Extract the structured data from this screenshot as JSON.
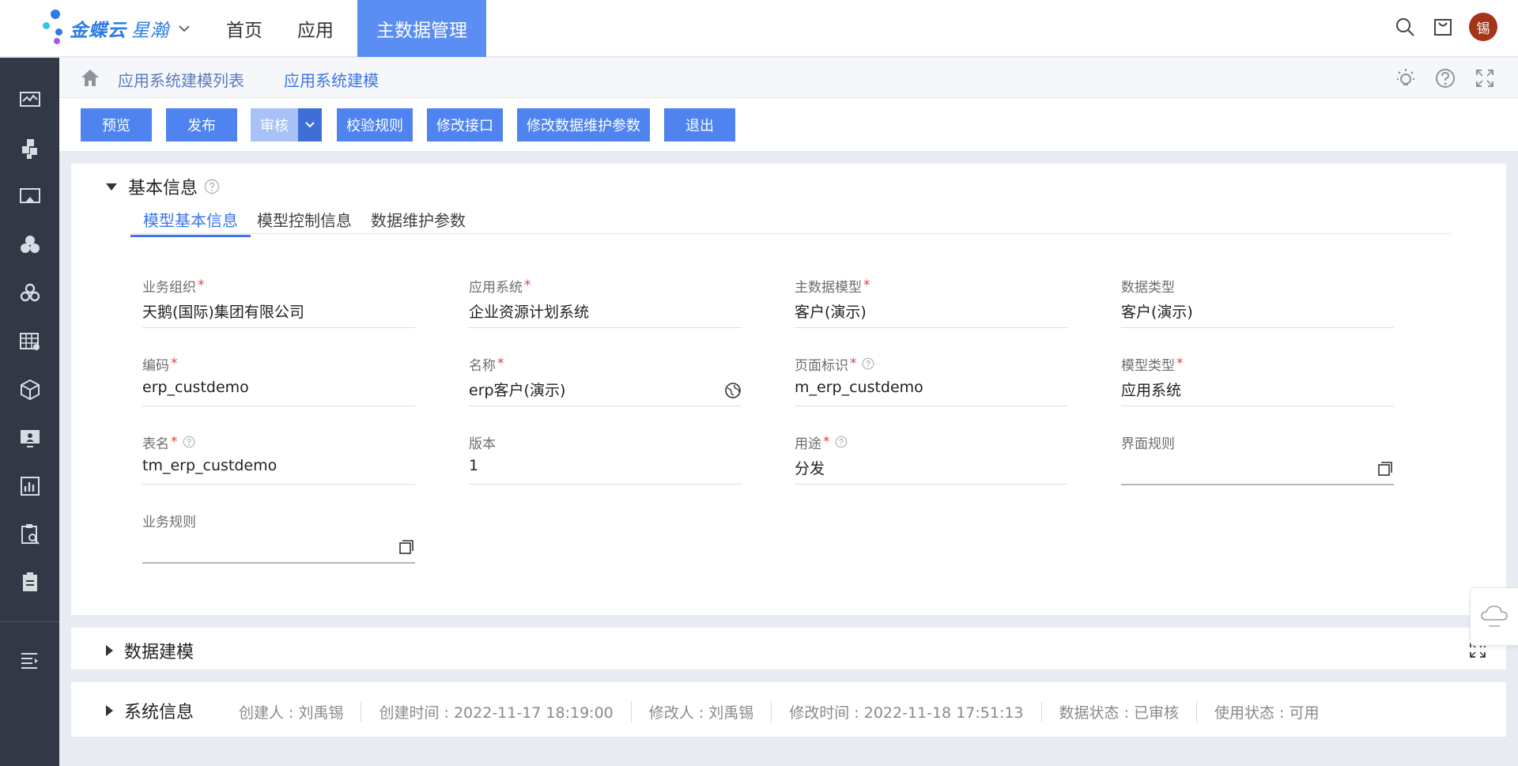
{
  "topbar": {
    "brand": "金蝶云",
    "brand_sub": "星瀚",
    "nav": [
      "首页",
      "应用",
      "主数据管理"
    ],
    "avatar": "锡"
  },
  "breadcrumb": {
    "items": [
      "应用系统建模列表",
      "应用系统建模"
    ]
  },
  "toolbar": {
    "preview": "预览",
    "publish": "发布",
    "audit": "审核",
    "validate": "校验规则",
    "edit_api": "修改接口",
    "edit_params": "修改数据维护参数",
    "exit": "退出"
  },
  "basic_info": {
    "title": "基本信息",
    "tabs": [
      "模型基本信息",
      "模型控制信息",
      "数据维护参数"
    ],
    "fields": {
      "org": {
        "label": "业务组织",
        "value": "天鹅(国际)集团有限公司"
      },
      "app": {
        "label": "应用系统",
        "value": "企业资源计划系统"
      },
      "master": {
        "label": "主数据模型",
        "value": "客户(演示)"
      },
      "dtype": {
        "label": "数据类型",
        "value": "客户(演示)"
      },
      "code": {
        "label": "编码",
        "value": "erp_custdemo"
      },
      "name": {
        "label": "名称",
        "value": "erp客户(演示)"
      },
      "page": {
        "label": "页面标识",
        "value": "m_erp_custdemo"
      },
      "mtype": {
        "label": "模型类型",
        "value": "应用系统"
      },
      "table": {
        "label": "表名",
        "value": "tm_erp_custdemo"
      },
      "version": {
        "label": "版本",
        "value": "1"
      },
      "usage": {
        "label": "用途",
        "value": "分发"
      },
      "ui_rule": {
        "label": "界面规则",
        "value": ""
      },
      "biz_rule": {
        "label": "业务规则",
        "value": ""
      }
    },
    "required_mark": "*"
  },
  "data_model": {
    "title": "数据建模"
  },
  "system_info": {
    "title": "系统信息",
    "creator": "创建人 : 刘禹锡",
    "created": "创建时间 : 2022-11-17 18:19:00",
    "modifier": "修改人 : 刘禹锡",
    "modified": "修改时间 : 2022-11-18 17:51:13",
    "data_status": "数据状态 : 已审核",
    "use_status": "使用状态 : 可用"
  },
  "colors": {
    "accent": "#4f83f0",
    "nav_active": "#5b8ef3",
    "sidebar": "#323845",
    "required": "#e64141"
  }
}
